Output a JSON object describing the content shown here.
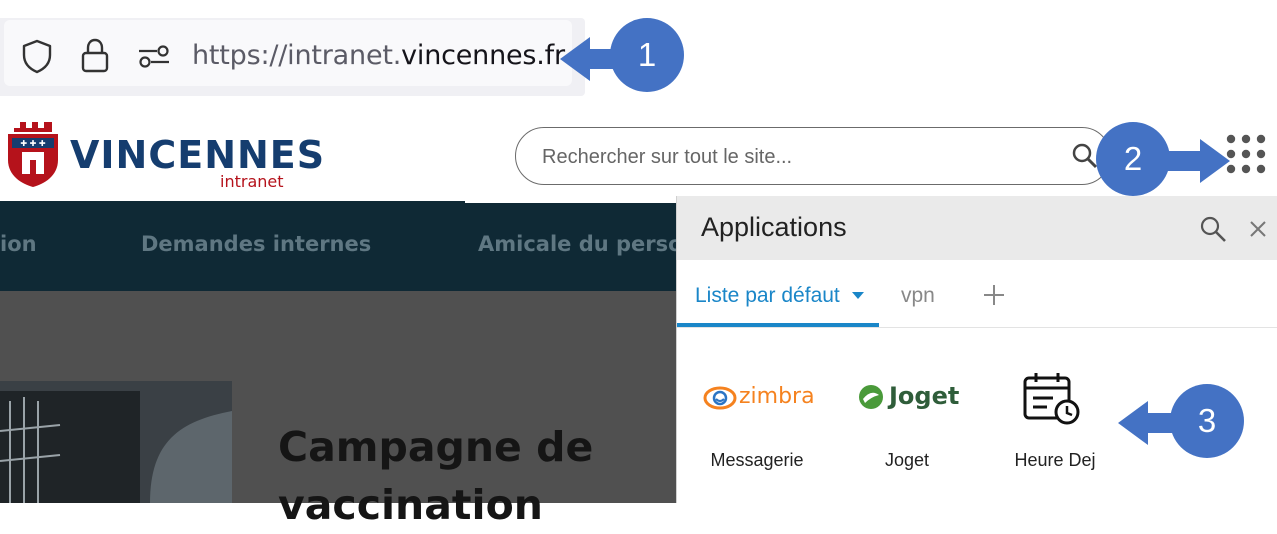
{
  "browser": {
    "url_prefix": "https://intranet.",
    "url_host": "vincennes.fr"
  },
  "callouts": [
    "1",
    "2",
    "3"
  ],
  "header": {
    "logo_title": "VINCENNES",
    "logo_subtitle": "intranet",
    "search_placeholder": "Rechercher sur tout le site..."
  },
  "nav": {
    "items": [
      "ion",
      "Demandes internes",
      "Amicale du perso"
    ]
  },
  "hero": {
    "title_lines": [
      "Campagne de",
      "vaccination"
    ]
  },
  "apps_panel": {
    "title": "Applications",
    "tabs": [
      "Liste par défaut",
      "vpn"
    ],
    "apps": [
      {
        "label": "Messagerie",
        "logo": "zimbra"
      },
      {
        "label": "Joget",
        "logo": "Joget"
      },
      {
        "label": "Heure Dej",
        "logo": ""
      }
    ]
  },
  "colors": {
    "callout": "#4472c4",
    "nav_bg": "#0f2935",
    "accent": "#1a86c8",
    "logo_blue": "#153d6f",
    "logo_red": "#b5121b"
  },
  "icons": [
    "shield-icon",
    "lock-icon",
    "permissions-icon",
    "search-icon",
    "apps-grid-icon",
    "close-icon",
    "plus-icon",
    "caret-down-icon",
    "calendar-clock-icon"
  ]
}
